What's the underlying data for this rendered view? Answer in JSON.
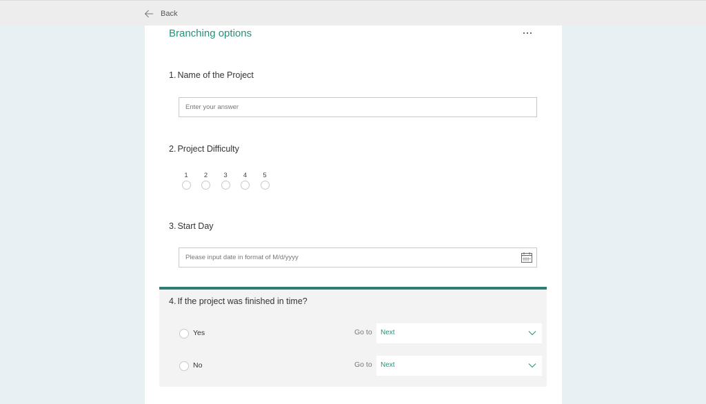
{
  "topbar": {
    "back_label": "Back"
  },
  "form": {
    "title": "Branching options",
    "more_icon": "more-horizontal-icon",
    "questions": [
      {
        "number": "1.",
        "title": "Name of the Project",
        "type": "text",
        "placeholder": "Enter your answer"
      },
      {
        "number": "2.",
        "title": "Project Difficulty",
        "type": "rating",
        "options": [
          "1",
          "2",
          "3",
          "4",
          "5"
        ]
      },
      {
        "number": "3.",
        "title": "Start Day",
        "type": "date",
        "placeholder": "Please input date in format of M/d/yyyy",
        "icon": "calendar-icon"
      },
      {
        "number": "4.",
        "title": "If the project was finished in time?",
        "type": "choice",
        "active": true,
        "accent_color": "#2f7e72",
        "options": [
          {
            "label": "Yes",
            "goto_label": "Go to",
            "goto_value": "Next"
          },
          {
            "label": "No",
            "goto_label": "Go to",
            "goto_value": "Next"
          }
        ]
      }
    ]
  },
  "colors": {
    "brand": "#258f7b",
    "page_bg": "#e7f0f2",
    "topbar_bg": "#ededed",
    "active_question_bg": "#f3f3f3"
  }
}
